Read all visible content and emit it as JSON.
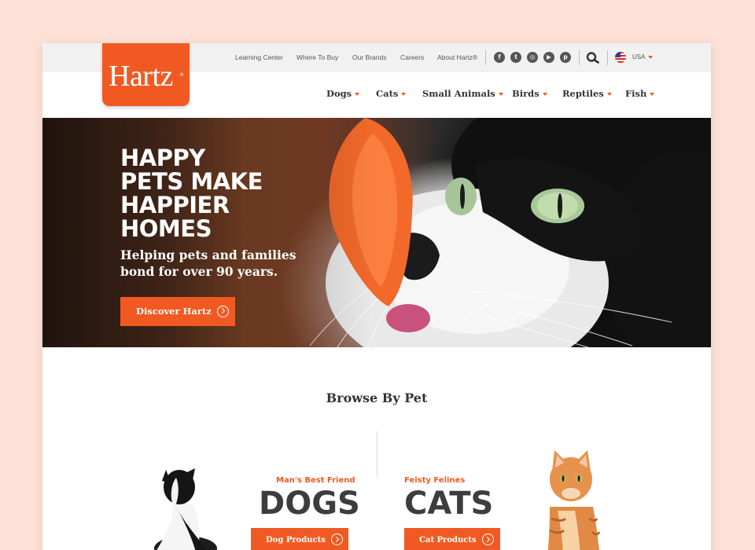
{
  "brand": {
    "logo_text": "Hartz",
    "reg_mark": "®",
    "accent_color": "#f05a22"
  },
  "utility_nav": {
    "links": [
      "Learning Center",
      "Where To Buy",
      "Our Brands",
      "Careers",
      "About Hartz®"
    ],
    "social_icons": [
      "facebook-icon",
      "twitter-icon",
      "instagram-icon",
      "youtube-icon",
      "pinterest-icon"
    ],
    "social_glyphs": [
      "f",
      "t",
      "◎",
      "▶",
      "p"
    ],
    "country": "USA"
  },
  "main_nav": {
    "items": [
      "Dogs",
      "Cats",
      "Small Animals",
      "Birds",
      "Reptiles",
      "Fish"
    ]
  },
  "hero": {
    "title_lines": [
      "HAPPY",
      "PETS MAKE",
      "HAPPIER",
      "HOMES"
    ],
    "subtitle_lines": [
      "Helping pets and families",
      "bond for over 90 years."
    ],
    "cta": "Discover Hartz"
  },
  "browse": {
    "title": "Browse By Pet",
    "dogs": {
      "tag": "Man's Best Friend",
      "name": "DOGS",
      "button": "Dog Products"
    },
    "cats": {
      "tag": "Feisty Felines",
      "name": "CATS",
      "button": "Cat Products"
    }
  }
}
